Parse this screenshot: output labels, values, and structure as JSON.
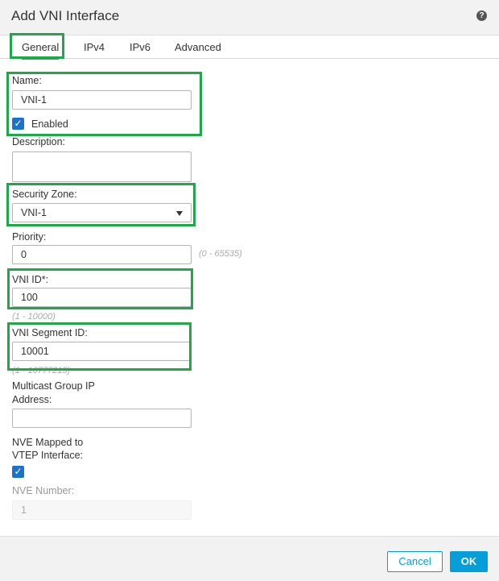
{
  "dialog": {
    "title": "Add VNI Interface",
    "help_icon": "?"
  },
  "tabs": [
    {
      "label": "General",
      "active": true
    },
    {
      "label": "IPv4"
    },
    {
      "label": "IPv6"
    },
    {
      "label": "Advanced"
    }
  ],
  "form": {
    "name": {
      "label": "Name:",
      "value": "VNI-1"
    },
    "enabled": {
      "label": "Enabled",
      "checked": true
    },
    "description": {
      "label": "Description:",
      "value": ""
    },
    "security_zone": {
      "label": "Security Zone:",
      "value": "VNI-1"
    },
    "priority": {
      "label": "Priority:",
      "value": "0",
      "hint": "(0 - 65535)"
    },
    "vni_id": {
      "label": "VNI ID*:",
      "value": "100",
      "hint": "(1 - 10000)"
    },
    "vni_segment_id": {
      "label": "VNI Segment ID:",
      "value": "10001",
      "hint": "(1 - 16777215)"
    },
    "multicast_group": {
      "label_line1": "Multicast Group IP",
      "label_line2": "Address:",
      "value": ""
    },
    "nve_mapped": {
      "label_line1": "NVE Mapped to",
      "label_line2": "VTEP Interface:",
      "checked": true
    },
    "nve_number": {
      "label": "NVE Number:",
      "value": "1"
    }
  },
  "footer": {
    "cancel_label": "Cancel",
    "ok_label": "OK"
  },
  "colors": {
    "highlight": "#1fa74a",
    "accent": "#049fd9",
    "checkbox": "#1a73c8"
  }
}
